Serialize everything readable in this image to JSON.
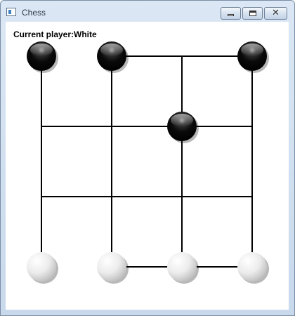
{
  "window": {
    "title": "Chess",
    "icon": "app-window-icon",
    "controls": {
      "minimize": "minimize-icon",
      "maximize": "maximize-icon",
      "close_glyph": "✕"
    }
  },
  "status": {
    "text": "Current player:White"
  },
  "game": {
    "grid_size": 4,
    "line_color": "#000000",
    "removed_edges": [
      {
        "from": [
          0,
          0
        ],
        "to": [
          1,
          0
        ]
      },
      {
        "from": [
          0,
          3
        ],
        "to": [
          1,
          3
        ]
      }
    ],
    "pieces": [
      {
        "color": "black",
        "col": 0,
        "row": 0
      },
      {
        "color": "black",
        "col": 1,
        "row": 0
      },
      {
        "color": "black",
        "col": 3,
        "row": 0
      },
      {
        "color": "black",
        "col": 2,
        "row": 1
      },
      {
        "color": "white",
        "col": 0,
        "row": 3
      },
      {
        "color": "white",
        "col": 1,
        "row": 3
      },
      {
        "color": "white",
        "col": 2,
        "row": 3
      },
      {
        "color": "white",
        "col": 3,
        "row": 3
      }
    ]
  }
}
